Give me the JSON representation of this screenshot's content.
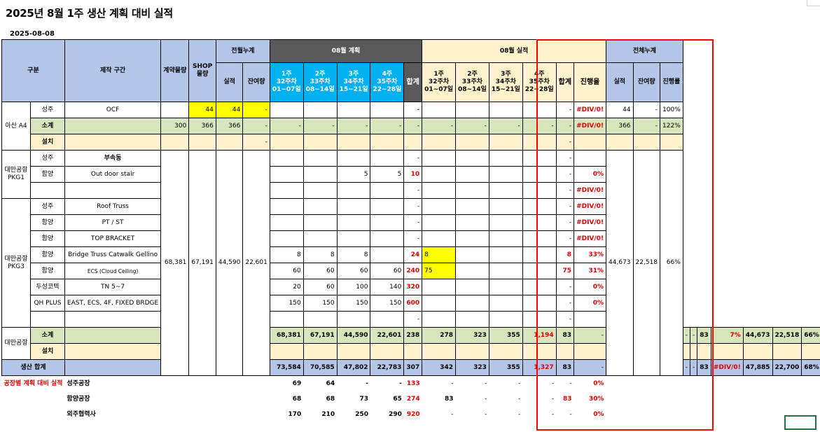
{
  "title": "2025년 8월 1주 생산 계획 대비 실적",
  "date": "2025-08-08",
  "headers": {
    "gubun": "구분",
    "section": "제작 구간",
    "contract": "계약물량",
    "shop": "SHOP 물량",
    "prev_month": "전월누계",
    "prev_actual": "실적",
    "prev_remain": "잔여량",
    "plan_title": "08월 계획",
    "weeks": [
      {
        "w": "1주",
        "n": "32주차",
        "d": "01~07일"
      },
      {
        "w": "2주",
        "n": "33주차",
        "d": "08~14일"
      },
      {
        "w": "3주",
        "n": "34주차",
        "d": "15~21일"
      },
      {
        "w": "4주",
        "n": "35주차",
        "d": "22~28일"
      }
    ],
    "plan_total": "합계",
    "actual_title": "08월 실적",
    "actual_total": "합계",
    "progress": "진행율",
    "cum_title": "전체누계",
    "cum_actual": "실적",
    "cum_remain": "잔여량",
    "cum_progress": "진행률"
  },
  "rows": {
    "asan": {
      "group": "아산 A4",
      "r1": {
        "a": "성주",
        "b": "OCF",
        "shop": "44",
        "prev": "44",
        "remain": "-",
        "ptotal": "-",
        "atotal": "-",
        "rate": "#DIV/0!",
        "ca": "44",
        "cr": "-",
        "cp": "100%"
      },
      "r2": {
        "a": "소계",
        "contract": "300",
        "shop": "366",
        "prev": "366",
        "remain": "-",
        "d": "-",
        "atotal": "-",
        "rate": "#DIV/0!",
        "ca": "366",
        "cr": "-",
        "cp": "122%"
      },
      "r3": {
        "a": "설치",
        "remain": "-",
        "atotal": "-"
      }
    },
    "pkg1": {
      "group": "대만공항 PKG1",
      "r1": {
        "a": "성주",
        "b": "부속동",
        "ptotal": "-",
        "atotal": "-"
      },
      "r2": {
        "a": "함양",
        "b": "Out door stair",
        "p3": "5",
        "p4": "5",
        "ptotal": "10",
        "atotal": "-",
        "rate": "0%"
      },
      "r3": {
        "ptotal": "-",
        "atotal": "-",
        "rate": "#DIV/0!"
      }
    },
    "pkg3": {
      "group": "대만공항 PKG3",
      "contract": "68,381",
      "shop": "67,191",
      "prev": "44,590",
      "remain": "22,601",
      "ca": "44,673",
      "cr": "22,518",
      "cp": "66%",
      "r1": {
        "a": "성주",
        "b": "Roof Truss",
        "ptotal": "-",
        "atotal": "-",
        "rate": "#DIV/0!"
      },
      "r2": {
        "a": "함양",
        "b": "PT / ST",
        "ptotal": "-",
        "atotal": "-",
        "rate": "#DIV/0!"
      },
      "r3": {
        "a": "함양",
        "b": "TOP BRACKET",
        "ptotal": "-",
        "atotal": "-",
        "rate": "#DIV/0!"
      },
      "r4": {
        "a": "함양",
        "b": "Bridge Truss Catwalk Gellino",
        "p1": "8",
        "p2": "8",
        "p3": "8",
        "ptotal": "24",
        "a1": "8",
        "atotal": "8",
        "rate": "33%"
      },
      "r5": {
        "a": "함양",
        "b": "ECS (Cloud Ceiling)",
        "p1": "60",
        "p2": "60",
        "p3": "60",
        "p4": "60",
        "ptotal": "240",
        "a1": "75",
        "atotal": "75",
        "rate": "31%"
      },
      "r6": {
        "a": "두성코텍",
        "b": "TN 5~7",
        "p1": "20",
        "p2": "60",
        "p3": "100",
        "p4": "140",
        "ptotal": "320",
        "atotal": "-",
        "rate": "0%"
      },
      "r7": {
        "a": "QH PLUS",
        "b": "EAST, ECS, 4F, FIXED BRDGE",
        "p1": "150",
        "p2": "150",
        "p3": "150",
        "p4": "150",
        "ptotal": "600",
        "atotal": "-",
        "rate": "0%"
      },
      "r8": {
        "ptotal": "-",
        "atotal": "-"
      }
    },
    "taiwan_sub": {
      "group": "대만공항",
      "a": "소계",
      "contract": "68,381",
      "shop": "67,191",
      "prev": "44,590",
      "remain": "22,601",
      "p1": "238",
      "p2": "278",
      "p3": "323",
      "p4": "355",
      "ptotal": "1,194",
      "a1": "83",
      "a2": "-",
      "a3": "-",
      "a4": "-",
      "atotal": "83",
      "rate": "7%",
      "ca": "44,673",
      "cr": "22,518",
      "cp": "66%",
      "install": "설치"
    },
    "total": {
      "label": "생산 합계",
      "contract": "73,584",
      "shop": "70,585",
      "prev": "47,802",
      "remain": "22,783",
      "p1": "307",
      "p2": "342",
      "p3": "323",
      "p4": "355",
      "ptotal": "1,327",
      "a1": "83",
      "a2": "-",
      "a3": "-",
      "a4": "-",
      "atotal": "83",
      "rate": "#DIV/0!",
      "ca": "47,885",
      "cr": "22,700",
      "cp": "68%"
    },
    "factory": {
      "label": "공장별 계획 대비 실적",
      "f1": {
        "name": "성주공장",
        "p1": "69",
        "p2": "64",
        "p3": "-",
        "p4": "-",
        "ptotal": "133",
        "a1": "-",
        "a2": "-",
        "a3": "-",
        "a4": "-",
        "atotal": "-",
        "rate": "0%"
      },
      "f2": {
        "name": "함양공장",
        "p1": "68",
        "p2": "68",
        "p3": "73",
        "p4": "65",
        "ptotal": "274",
        "a1": "83",
        "a2": "-",
        "a3": "-",
        "a4": "-",
        "atotal": "83",
        "rate": "30%"
      },
      "f3": {
        "name": "외주협력사",
        "p1": "170",
        "p2": "210",
        "p3": "250",
        "p4": "290",
        "ptotal": "920",
        "a1": "-",
        "a2": "-",
        "a3": "-",
        "a4": "-",
        "atotal": "-",
        "rate": "0%"
      }
    }
  }
}
